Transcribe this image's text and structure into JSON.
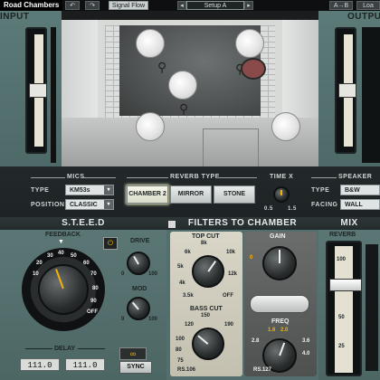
{
  "toolbar": {
    "brand": "Road Chambers",
    "undo_label": "↶",
    "redo_label": "↷",
    "signal_flow_label": "Signal Flow",
    "preset_nav_prev": "◂",
    "preset_name": "Setup A",
    "preset_nav_next": "▸",
    "ab_label": "A→B",
    "load_label": "Loa"
  },
  "input": {
    "title": "INPUT"
  },
  "output": {
    "title": "OUTPUT"
  },
  "mics": {
    "section_label": "MICS",
    "type_label": "TYPE",
    "type_value": "KM53s",
    "position_label": "POSITION",
    "position_value": "CLASSIC"
  },
  "reverb_type": {
    "section_label": "REVERB TYPE",
    "options": [
      "CHAMBER 2",
      "MIRROR",
      "STONE"
    ],
    "selected": "CHAMBER 2"
  },
  "time_x": {
    "section_label": "TIME X",
    "min_label": "0.5",
    "max_label": "1.5"
  },
  "speaker": {
    "section_label": "SPEAKER",
    "type_label": "TYPE",
    "type_value": "B&W",
    "facing_label": "FACING",
    "facing_value": "WALL"
  },
  "steed": {
    "title": "S.T.E.E.D",
    "feedback_label": "FEEDBACK",
    "feedback_scale": [
      "10",
      "20",
      "30",
      "40",
      "50",
      "60",
      "70",
      "80",
      "90",
      "OFF"
    ],
    "drive_label": "DRIVE",
    "drive_min": "0",
    "drive_max": "100",
    "mod_label": "MOD",
    "mod_min": "0",
    "mod_max": "100",
    "delay_label": "DELAY",
    "delay_left": "111.0",
    "delay_right": "111.0",
    "sync_label": "SYNC"
  },
  "filters": {
    "title": "FILTERS TO CHAMBER",
    "topcut_label": "TOP CUT",
    "topcut_scale": [
      "8k",
      "6k",
      "10k",
      "5k",
      "12k",
      "4k",
      "3.5k",
      "OFF"
    ],
    "basscut_label": "BASS CUT",
    "basscut_scale": [
      "150",
      "120",
      "190",
      "100",
      "80",
      "75",
      "RS.106"
    ],
    "plate_model_left": "RS.106",
    "gain_label": "GAIN",
    "gain_min": "0",
    "freq_label": "FREQ",
    "freq_scale": [
      "1.6",
      "2.0",
      "2.8",
      "3.6",
      "4.0"
    ],
    "plate_model_right": "RS.127"
  },
  "mix": {
    "title": "MIX",
    "reverb_label": "REVERB",
    "fader_scale": [
      "100",
      "75",
      "50",
      "25"
    ]
  }
}
